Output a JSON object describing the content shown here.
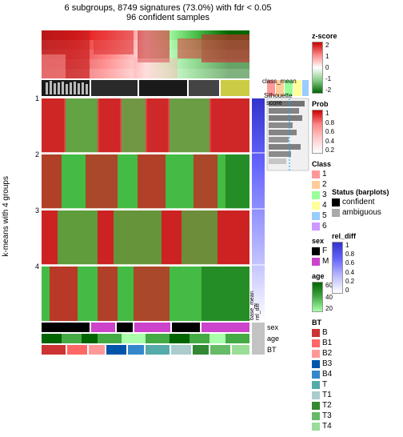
{
  "title": {
    "line1": "6 subgroups, 8749 signatures (73.0%) with fdr < 0.05",
    "line2": "96 confident samples"
  },
  "y_axis_label": "k-means with 4 groups",
  "group_labels": [
    "1",
    "2",
    "3",
    "4"
  ],
  "annotation_row_labels": [
    "sex",
    "age",
    "BT"
  ],
  "bottom_labels": [
    "base_mean",
    "rel_diff",
    "BT"
  ],
  "legend": {
    "zscore_title": "z-score",
    "zscore_values": [
      "2",
      "1",
      "0",
      "-1",
      "-2"
    ],
    "prob_title": "Prob",
    "prob_values": [
      "1",
      "0.8",
      "0.6",
      "0.4",
      "0.2"
    ],
    "class_title": "Class",
    "class_items": [
      {
        "label": "1",
        "color": "#FF9999"
      },
      {
        "label": "2",
        "color": "#FFCC99"
      },
      {
        "label": "3",
        "color": "#99FF99"
      },
      {
        "label": "4",
        "color": "#FFFF99"
      },
      {
        "label": "5",
        "color": "#99CCFF"
      },
      {
        "label": "6",
        "color": "#CC99FF"
      }
    ],
    "sex_title": "sex",
    "sex_items": [
      {
        "label": "F",
        "color": "#000000"
      },
      {
        "label": "M",
        "color": "#CC44CC"
      }
    ],
    "age_title": "age",
    "age_items": [
      {
        "label": "60",
        "color": "#006400"
      },
      {
        "label": "40",
        "color": "#44aa44"
      },
      {
        "label": "20",
        "color": "#aaffaa"
      }
    ],
    "bt_title": "BT",
    "bt_items": [
      {
        "label": "B",
        "color": "#cc3333"
      },
      {
        "label": "B1",
        "color": "#ff6666"
      },
      {
        "label": "B2",
        "color": "#ff9999"
      },
      {
        "label": "B3",
        "color": "#0055aa"
      },
      {
        "label": "B4",
        "color": "#3388cc"
      },
      {
        "label": "T",
        "color": "#55aaaa"
      },
      {
        "label": "T1",
        "color": "#aacccc"
      },
      {
        "label": "T2",
        "color": "#338833"
      },
      {
        "label": "T3",
        "color": "#66bb66"
      },
      {
        "label": "T4",
        "color": "#99dd99"
      }
    ]
  },
  "status": {
    "title": "Status (barplots)",
    "items": [
      {
        "label": "confident",
        "color": "#000000"
      },
      {
        "label": "ambiguous",
        "color": "#aaaaaa"
      }
    ]
  },
  "rel_diff_title": "rel_diff",
  "rel_diff_values": [
    "1",
    "0.8",
    "0.6",
    "0.4",
    "0.2",
    "0"
  ],
  "class_mean_title": "class_mean",
  "silhouette_title": "Silhouette\nscore"
}
